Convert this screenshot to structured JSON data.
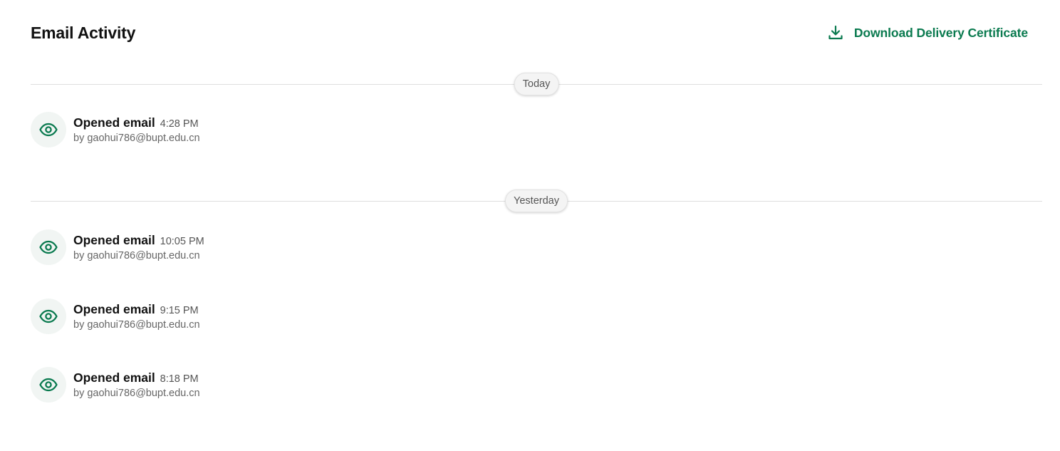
{
  "header": {
    "title": "Email Activity",
    "download_label": "Download Delivery Certificate",
    "download_icon": "download-icon"
  },
  "colors": {
    "accent": "#0a7a4f",
    "icon_bg": "#f1f5f3",
    "divider": "#dedede"
  },
  "groups": [
    {
      "label": "Today",
      "events": [
        {
          "action": "Opened email",
          "time": "4:28 PM",
          "by": "by gaohui786@bupt.edu.cn",
          "icon": "eye-icon"
        }
      ]
    },
    {
      "label": "Yesterday",
      "events": [
        {
          "action": "Opened email",
          "time": "10:05 PM",
          "by": "by gaohui786@bupt.edu.cn",
          "icon": "eye-icon"
        },
        {
          "action": "Opened email",
          "time": "9:15 PM",
          "by": "by gaohui786@bupt.edu.cn",
          "icon": "eye-icon"
        },
        {
          "action": "Opened email",
          "time": "8:18 PM",
          "by": "by gaohui786@bupt.edu.cn",
          "icon": "eye-icon"
        }
      ]
    }
  ]
}
